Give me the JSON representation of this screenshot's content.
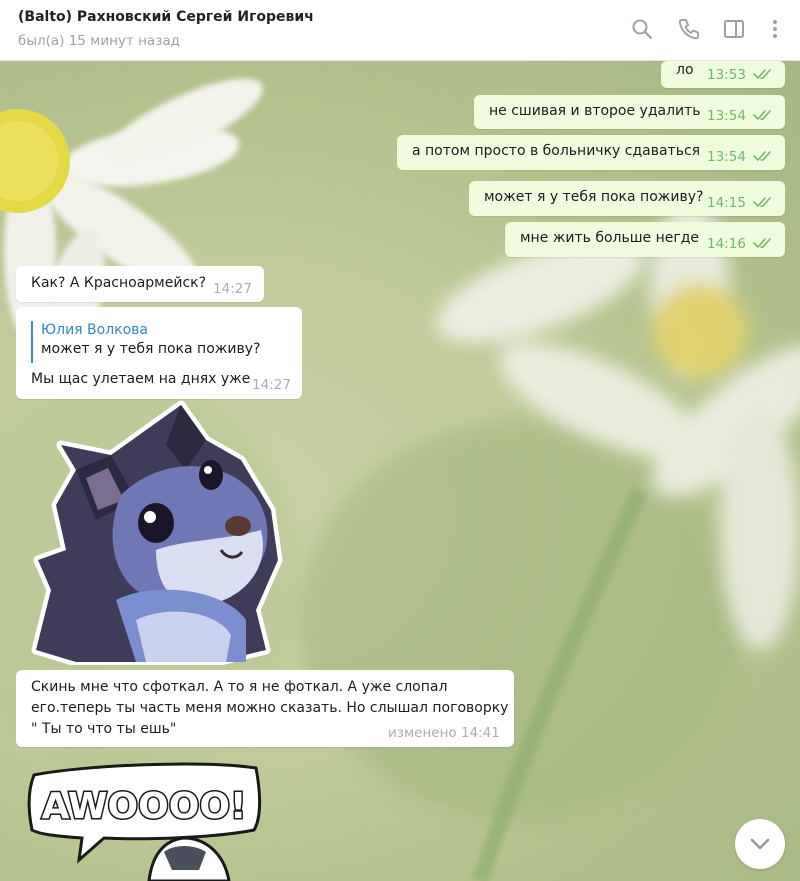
{
  "header": {
    "title": "(Balto) Рахновский Сергей Игоревич",
    "status": "был(а) 15 минут назад"
  },
  "icons": [
    "search-icon",
    "phone-icon",
    "sidebar-icon",
    "more-icon",
    "double-check-icon",
    "chevron-down-icon"
  ],
  "colors": {
    "outgoing_bubble": "#effdde",
    "incoming_bubble": "#ffffff",
    "read_checks": "#6fb868",
    "reply_accent": "#3a8fd1"
  },
  "messages": [
    {
      "text": "ло",
      "time": "13:53"
    },
    {
      "text": "не сшивая и второе удалить",
      "time": "13:54"
    },
    {
      "text": "а потом просто в больничку сдаваться",
      "time": "13:54"
    },
    {
      "text": "может я у тебя пока поживу?",
      "time": "14:15"
    },
    {
      "text": "мне жить больше негде",
      "time": "14:16"
    },
    {
      "text": "Как? А Красноармейск?",
      "time": "14:27"
    },
    {
      "reply_name": "Юлия Волкова",
      "reply_text": "может я у тебя пока поживу?",
      "text": "Мы щас улетаем на днях уже",
      "time": "14:27"
    },
    {
      "line1": "Скинь мне что сфоткал. А то я не фоткал. А уже слопал",
      "line2": "его.теперь ты часть меня можно сказать. Но слышал поговорку",
      "line3": "\" Ты то что ты ешь\"",
      "time": "изменено 14:41"
    }
  ],
  "sticker2_text": "AWOOOO!"
}
